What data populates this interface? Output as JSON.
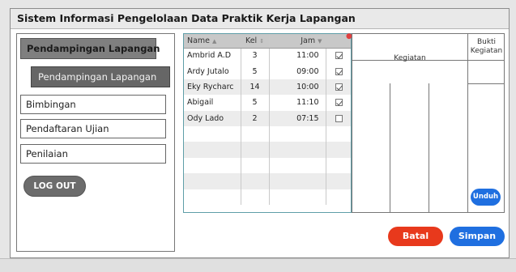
{
  "window": {
    "title": "Sistem Informasi Pengelolaan Data Praktik Kerja Lapangan"
  },
  "sidebar": {
    "header": "Pendampingan Lapangan",
    "active_item": "Pendampingan Lapangan",
    "items": [
      {
        "label": "Bimbingan"
      },
      {
        "label": "Pendaftaran Ujian"
      },
      {
        "label": "Penilaian"
      }
    ],
    "logout_label": "LOG OUT"
  },
  "table": {
    "columns": [
      "Name",
      "Kel",
      "Jam"
    ],
    "rows": [
      {
        "name": "Ambrid A.D",
        "kel": "3",
        "jam": "11:00",
        "checked": true
      },
      {
        "name": "Ardy Jutalo",
        "kel": "5",
        "jam": "09:00",
        "checked": true
      },
      {
        "name": "Eky Rycharc",
        "kel": "14",
        "jam": "10:00",
        "checked": true
      },
      {
        "name": "Abigail",
        "kel": "5",
        "jam": "11:10",
        "checked": true
      },
      {
        "name": "Ody Lado",
        "kel": "2",
        "jam": "07:15",
        "checked": false
      }
    ],
    "empty_rows": 5
  },
  "kegiatan_panel": {
    "kegiatan_header": "Kegiatan",
    "bukti_header": "Bukti\nKegiatan",
    "download_label": "Unduh"
  },
  "actions": {
    "cancel_label": "Batal",
    "save_label": "Simpan"
  },
  "colors": {
    "cancel": "#e8391c",
    "save": "#1f6fe0",
    "grid_border": "#5f9ea8"
  }
}
